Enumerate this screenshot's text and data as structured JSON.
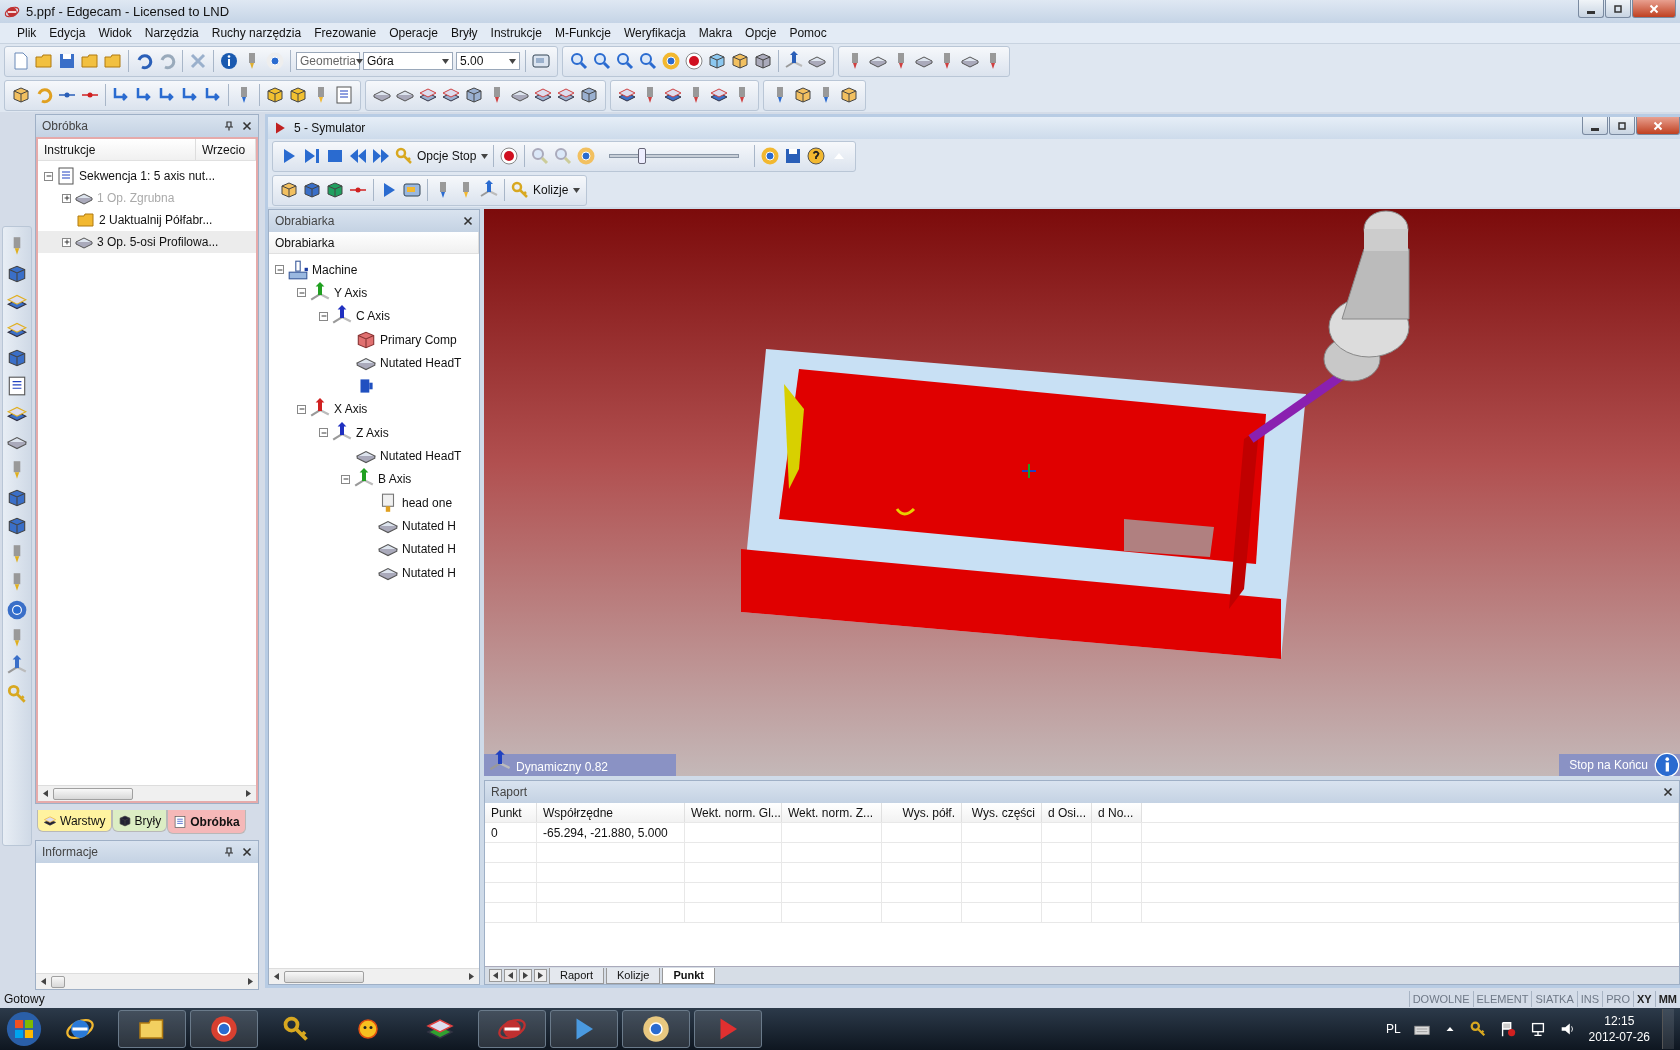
{
  "window": {
    "title": "5.ppf - Edgecam - Licensed to LND"
  },
  "menu": [
    "Plik",
    "Edycja",
    "Widok",
    "Narzędzia",
    "Ruchy narzędzia",
    "Frezowanie",
    "Operacje",
    "Bryły",
    "Instrukcje",
    "M-Funkcje",
    "Weryfikacja",
    "Makra",
    "Opcje",
    "Pomoc"
  ],
  "toolbar": {
    "dropdowns": [
      {
        "value": "Geometria"
      },
      {
        "value": "Góra"
      },
      {
        "value": "5.00"
      }
    ]
  },
  "ops_panel": {
    "title": "Obróbka",
    "columns": [
      "Instrukcje",
      "Wrzecio"
    ],
    "tree": [
      {
        "label": "Sekwencja 1: 5 axis nut...",
        "kind": "sequence",
        "expanded": true,
        "selected": false,
        "disabled": false,
        "children": [
          {
            "label": "1 Op. Zgrubna",
            "kind": "operation",
            "expanded": false,
            "selected": false,
            "disabled": true
          },
          {
            "label": "2 Uaktualnij Półfabr...",
            "kind": "update",
            "selected": false,
            "disabled": false
          },
          {
            "label": "3 Op. 5-osi Profilowa...",
            "kind": "operation",
            "expanded": false,
            "selected": true,
            "disabled": false
          }
        ]
      }
    ],
    "tabs": [
      {
        "label": "Warstwy",
        "selected": false,
        "color": "#fff3a0"
      },
      {
        "label": "Bryły",
        "selected": false,
        "color": "#dcedc4"
      },
      {
        "label": "Obróbka",
        "selected": true,
        "color": "#f5b8b8"
      }
    ]
  },
  "info_panel": {
    "title": "Informacje"
  },
  "simulator": {
    "title": "5 - Symulator",
    "stop_options": "Opcje Stop",
    "speed": {
      "level": 0.25
    },
    "collisions": "Kolizje",
    "machine_panel": {
      "title": "Obrabiarka",
      "header": "Obrabiarka",
      "tree": [
        {
          "label": "Machine",
          "kind": "machine",
          "expanded": true,
          "children": [
            {
              "label": "Y Axis",
              "kind": "axis",
              "color": "#20a020",
              "expanded": true,
              "children": [
                {
                  "label": "C Axis",
                  "kind": "axis",
                  "color": "#2030c0",
                  "expanded": true,
                  "children": [
                    {
                      "label": "Primary Comp",
                      "kind": "part"
                    },
                    {
                      "label": "Nutated HeadT",
                      "kind": "solid"
                    },
                    {
                      "kind": "clamp"
                    }
                  ]
                }
              ]
            },
            {
              "label": "X Axis",
              "kind": "axis",
              "color": "#d02020",
              "expanded": true,
              "children": [
                {
                  "label": "Z Axis",
                  "kind": "axis",
                  "color": "#2030c0",
                  "expanded": true,
                  "children": [
                    {
                      "label": "Nutated HeadT",
                      "kind": "solid"
                    },
                    {
                      "label": "B Axis",
                      "kind": "axis",
                      "color": "#20a020",
                      "expanded": true,
                      "children": [
                        {
                          "label": "head one",
                          "kind": "head"
                        },
                        {
                          "label": "Nutated H",
                          "kind": "solid"
                        },
                        {
                          "label": "Nutated H",
                          "kind": "solid"
                        },
                        {
                          "label": "Nutated H",
                          "kind": "solid"
                        }
                      ]
                    }
                  ]
                }
              ]
            }
          ]
        }
      ]
    },
    "viewport": {
      "mode": "Dynamiczny 0.82",
      "stop": "Stop na Końcu"
    },
    "report": {
      "title": "Raport",
      "columns": [
        "Punkt",
        "Współrzędne",
        "Wekt. norm. Gl...",
        "Wekt. norm. Z...",
        "Wys. półf.",
        "Wys. części",
        "d Osi...",
        "d No..."
      ],
      "rows": [
        [
          "0",
          "-65.294, -21.880, 5.000"
        ]
      ],
      "tabs": [
        {
          "label": "Raport",
          "selected": false
        },
        {
          "label": "Kolizje",
          "selected": false
        },
        {
          "label": "Punkt",
          "selected": true
        }
      ]
    }
  },
  "status_bar": {
    "text": "Gotowy",
    "indicators": [
      {
        "label": "DOWOLNE",
        "on": false
      },
      {
        "label": "ELEMENT",
        "on": false
      },
      {
        "label": "SIATKA",
        "on": false
      },
      {
        "label": "INS",
        "on": false
      },
      {
        "label": "PRO",
        "on": false
      },
      {
        "label": "XY",
        "on": true
      },
      {
        "label": "MM",
        "on": true
      }
    ]
  },
  "taskbar": {
    "language": "PL",
    "time": "12:15",
    "date": "2012-07-26"
  }
}
